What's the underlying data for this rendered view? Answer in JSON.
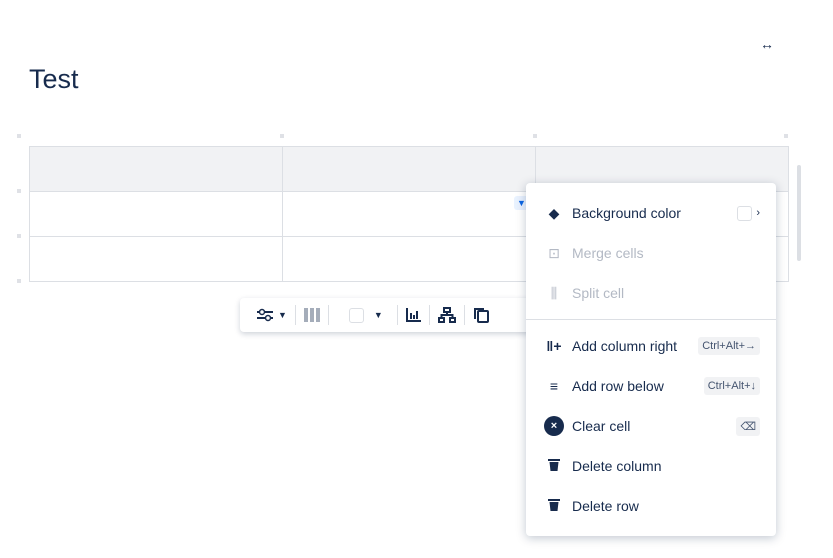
{
  "page": {
    "title": "Test",
    "expand_icon": "↔"
  },
  "toolbar": {
    "items": [
      {
        "icon": "sliders-icon"
      },
      {
        "icon": "columns-icon"
      },
      {
        "icon": "color-swatch"
      },
      {
        "icon": "chart-icon"
      },
      {
        "icon": "hierarchy-icon"
      },
      {
        "icon": "copy-icon"
      }
    ]
  },
  "menu": {
    "background_color": "Background color",
    "merge_cells": "Merge cells",
    "split_cell": "Split cell",
    "add_column_right": "Add column right",
    "add_column_right_shortcut": "Ctrl+Alt+→",
    "add_row_below": "Add row below",
    "add_row_below_shortcut": "Ctrl+Alt+↓",
    "clear_cell": "Clear cell",
    "clear_cell_shortcut": "⌫",
    "delete_column": "Delete column",
    "delete_row": "Delete row"
  }
}
